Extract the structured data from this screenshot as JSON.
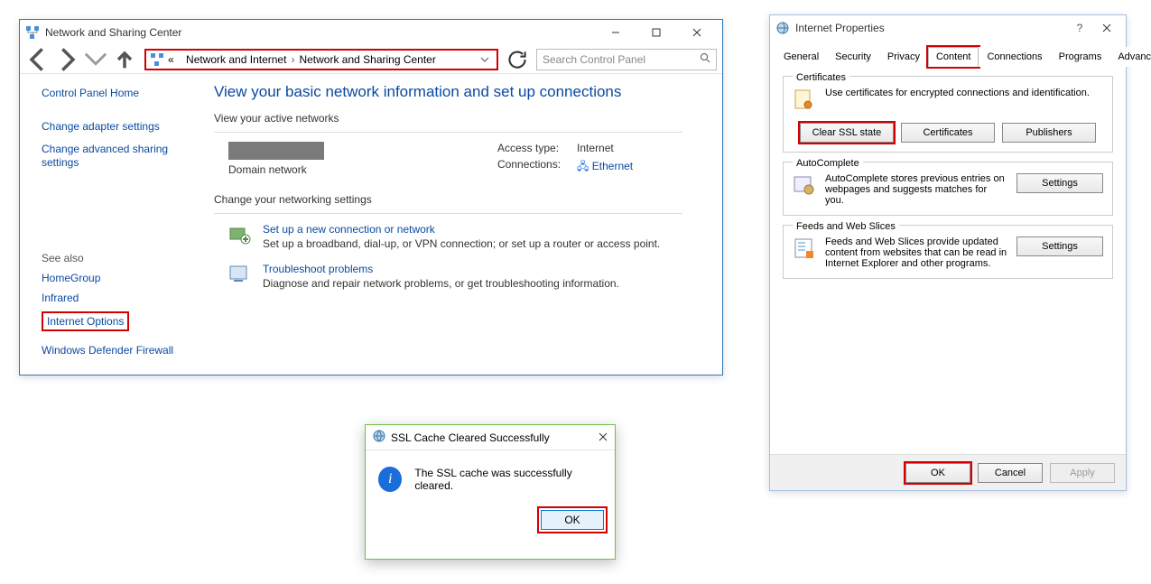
{
  "win1": {
    "title": "Network and Sharing Center",
    "breadcrumb": {
      "prefix": "«",
      "seg1": "Network and Internet",
      "seg2": "Network and Sharing Center"
    },
    "search_placeholder": "Search Control Panel",
    "left": {
      "home": "Control Panel Home",
      "adapter": "Change adapter settings",
      "advanced": "Change advanced sharing settings",
      "see_also": "See also",
      "homegroup": "HomeGroup",
      "infrared": "Infrared",
      "inetopt": "Internet Options",
      "firewall": "Windows Defender Firewall"
    },
    "main": {
      "heading": "View your basic network information and set up connections",
      "active_label": "View your active networks",
      "domain_label": "Domain network",
      "access_k": "Access type:",
      "access_v": "Internet",
      "conn_k": "Connections:",
      "conn_v": "Ethernet",
      "chg_label": "Change your networking settings",
      "task1_t": "Set up a new connection or network",
      "task1_d": "Set up a broadband, dial-up, or VPN connection; or set up a router or access point.",
      "task2_t": "Troubleshoot problems",
      "task2_d": "Diagnose and repair network problems, or get troubleshooting information."
    }
  },
  "dlg": {
    "title": "SSL Cache Cleared Successfully",
    "msg": "The SSL cache was successfully cleared.",
    "ok": "OK"
  },
  "win2": {
    "title": "Internet Properties",
    "tabs": [
      "General",
      "Security",
      "Privacy",
      "Content",
      "Connections",
      "Programs",
      "Advanced"
    ],
    "active_tab": "Content",
    "cert": {
      "title": "Certificates",
      "desc": "Use certificates for encrypted connections and identification.",
      "clear": "Clear SSL state",
      "certs": "Certificates",
      "pubs": "Publishers"
    },
    "auto": {
      "title": "AutoComplete",
      "desc": "AutoComplete stores previous entries on webpages and suggests matches for you.",
      "btn": "Settings"
    },
    "feeds": {
      "title": "Feeds and Web Slices",
      "desc": "Feeds and Web Slices provide updated content from websites that can be read in Internet Explorer and other programs.",
      "btn": "Settings"
    },
    "footer": {
      "ok": "OK",
      "cancel": "Cancel",
      "apply": "Apply"
    }
  }
}
